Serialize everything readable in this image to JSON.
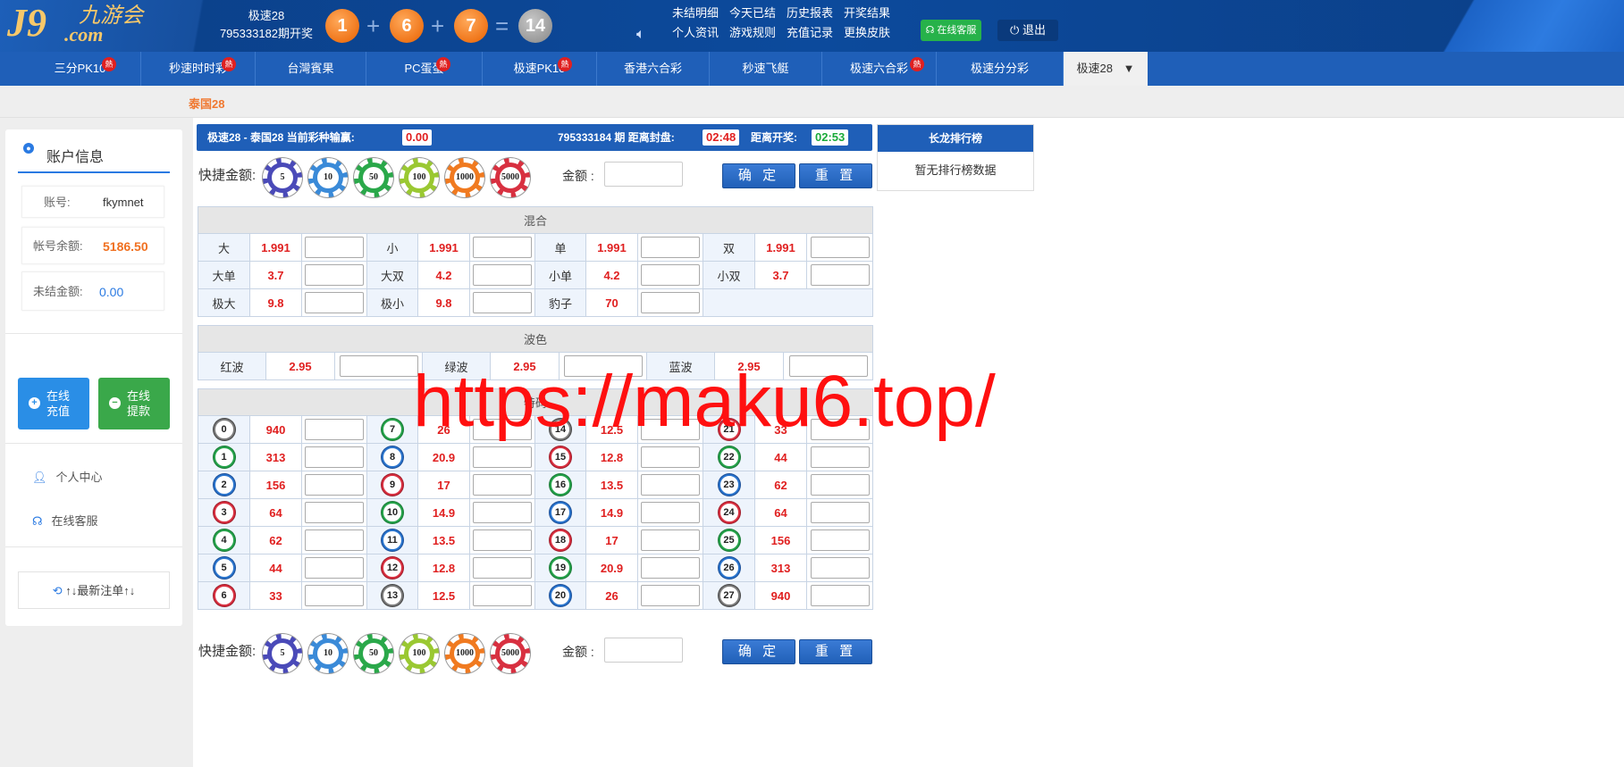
{
  "header": {
    "logo_main": "J9",
    "logo_cn": "九游会",
    "logo_com": ".com",
    "game": "极速28",
    "draw_text": "795333182期开奖",
    "balls": [
      "1",
      "6",
      "7"
    ],
    "plus": "+",
    "equals": "=",
    "sum": "14",
    "links": [
      "未结明细",
      "今天已结",
      "历史报表",
      "开奖结果",
      "个人资讯",
      "游戏规则",
      "充值记录",
      "更换皮肤"
    ],
    "service_label": "在线客服",
    "logout_label": "退出"
  },
  "nav": {
    "hot_label": "熱",
    "items": [
      {
        "label": "三分PK10",
        "hot": true
      },
      {
        "label": "秒速时时彩",
        "hot": true
      },
      {
        "label": "台灣賓果",
        "hot": false
      },
      {
        "label": "PC蛋蛋",
        "hot": true
      },
      {
        "label": "极速PK10",
        "hot": true
      },
      {
        "label": "香港六合彩",
        "hot": false
      },
      {
        "label": "秒速飞艇",
        "hot": false
      },
      {
        "label": "极速六合彩",
        "hot": true
      },
      {
        "label": "极速分分彩",
        "hot": false
      },
      {
        "label": "极速28",
        "hot": false
      }
    ],
    "active_arrow": "▼"
  },
  "subbar": {
    "label": "泰国28"
  },
  "sidebar": {
    "title": "账户信息",
    "account_label": "账号:",
    "account_value": "fkymnet",
    "balance_label": "帐号余额:",
    "balance_value": "5186.50",
    "unsettled_label": "未结金额:",
    "unsettled_value": "0.00",
    "recharge_label": "在线充值",
    "withdraw_label": "在线提款",
    "menu": [
      "个人中心",
      "在线客服"
    ],
    "recent_label": "↑↓最新注单↑↓",
    "colors": {
      "accent": "#2a7ae2",
      "recharge": "#2a8ee6",
      "withdraw": "#3aa84a",
      "balance": "#f07020"
    }
  },
  "infobar": {
    "left": "极速28 - 泰国28 当前彩种输赢:",
    "winloss": "0.00",
    "period": "795333184 期 距离封盘:",
    "close_time": "02:48",
    "open_label": "距离开奖:",
    "open_time": "02:53"
  },
  "ranking": {
    "title": "长龙排行榜",
    "empty": "暂无排行榜数据"
  },
  "quick": {
    "label": "快捷金额:",
    "chips": [
      {
        "value": "5",
        "color": "#4a4ab8"
      },
      {
        "value": "10",
        "color": "#3a8ad8"
      },
      {
        "value": "50",
        "color": "#2aa84a"
      },
      {
        "value": "100",
        "color": "#9ac832"
      },
      {
        "value": "1000",
        "color": "#f07a20"
      },
      {
        "value": "5000",
        "color": "#d83040"
      }
    ],
    "amount_label": "金额 :",
    "confirm": "确 定",
    "reset": "重 置"
  },
  "mix": {
    "title": "混合",
    "rows": [
      [
        {
          "n": "大",
          "o": "1.991"
        },
        {
          "n": "小",
          "o": "1.991"
        },
        {
          "n": "单",
          "o": "1.991"
        },
        {
          "n": "双",
          "o": "1.991"
        }
      ],
      [
        {
          "n": "大单",
          "o": "3.7"
        },
        {
          "n": "大双",
          "o": "4.2"
        },
        {
          "n": "小单",
          "o": "4.2"
        },
        {
          "n": "小双",
          "o": "3.7"
        }
      ],
      [
        {
          "n": "极大",
          "o": "9.8"
        },
        {
          "n": "极小",
          "o": "9.8"
        },
        {
          "n": "豹子",
          "o": "70"
        }
      ]
    ]
  },
  "wave": {
    "title": "波色",
    "items": [
      {
        "n": "红波",
        "o": "2.95"
      },
      {
        "n": "绿波",
        "o": "2.95"
      },
      {
        "n": "蓝波",
        "o": "2.95"
      }
    ]
  },
  "special": {
    "title": "特码",
    "cols": [
      [
        {
          "n": "0",
          "o": "940",
          "c": "gray"
        },
        {
          "n": "1",
          "o": "313",
          "c": "green"
        },
        {
          "n": "2",
          "o": "156",
          "c": "blue"
        },
        {
          "n": "3",
          "o": "64",
          "c": "red"
        },
        {
          "n": "4",
          "o": "62",
          "c": "green"
        },
        {
          "n": "5",
          "o": "44",
          "c": "blue"
        },
        {
          "n": "6",
          "o": "33",
          "c": "red"
        }
      ],
      [
        {
          "n": "7",
          "o": "26",
          "c": "green"
        },
        {
          "n": "8",
          "o": "20.9",
          "c": "blue"
        },
        {
          "n": "9",
          "o": "17",
          "c": "red"
        },
        {
          "n": "10",
          "o": "14.9",
          "c": "green"
        },
        {
          "n": "11",
          "o": "13.5",
          "c": "blue"
        },
        {
          "n": "12",
          "o": "12.8",
          "c": "red"
        },
        {
          "n": "13",
          "o": "12.5",
          "c": "gray"
        }
      ],
      [
        {
          "n": "14",
          "o": "12.5",
          "c": "gray"
        },
        {
          "n": "15",
          "o": "12.8",
          "c": "red"
        },
        {
          "n": "16",
          "o": "13.5",
          "c": "green"
        },
        {
          "n": "17",
          "o": "14.9",
          "c": "blue"
        },
        {
          "n": "18",
          "o": "17",
          "c": "red"
        },
        {
          "n": "19",
          "o": "20.9",
          "c": "green"
        },
        {
          "n": "20",
          "o": "26",
          "c": "blue"
        }
      ],
      [
        {
          "n": "21",
          "o": "33",
          "c": "red"
        },
        {
          "n": "22",
          "o": "44",
          "c": "green"
        },
        {
          "n": "23",
          "o": "62",
          "c": "blue"
        },
        {
          "n": "24",
          "o": "64",
          "c": "red"
        },
        {
          "n": "25",
          "o": "156",
          "c": "green"
        },
        {
          "n": "26",
          "o": "313",
          "c": "blue"
        },
        {
          "n": "27",
          "o": "940",
          "c": "gray"
        }
      ]
    ]
  },
  "watermark": "https://maku6.top/"
}
